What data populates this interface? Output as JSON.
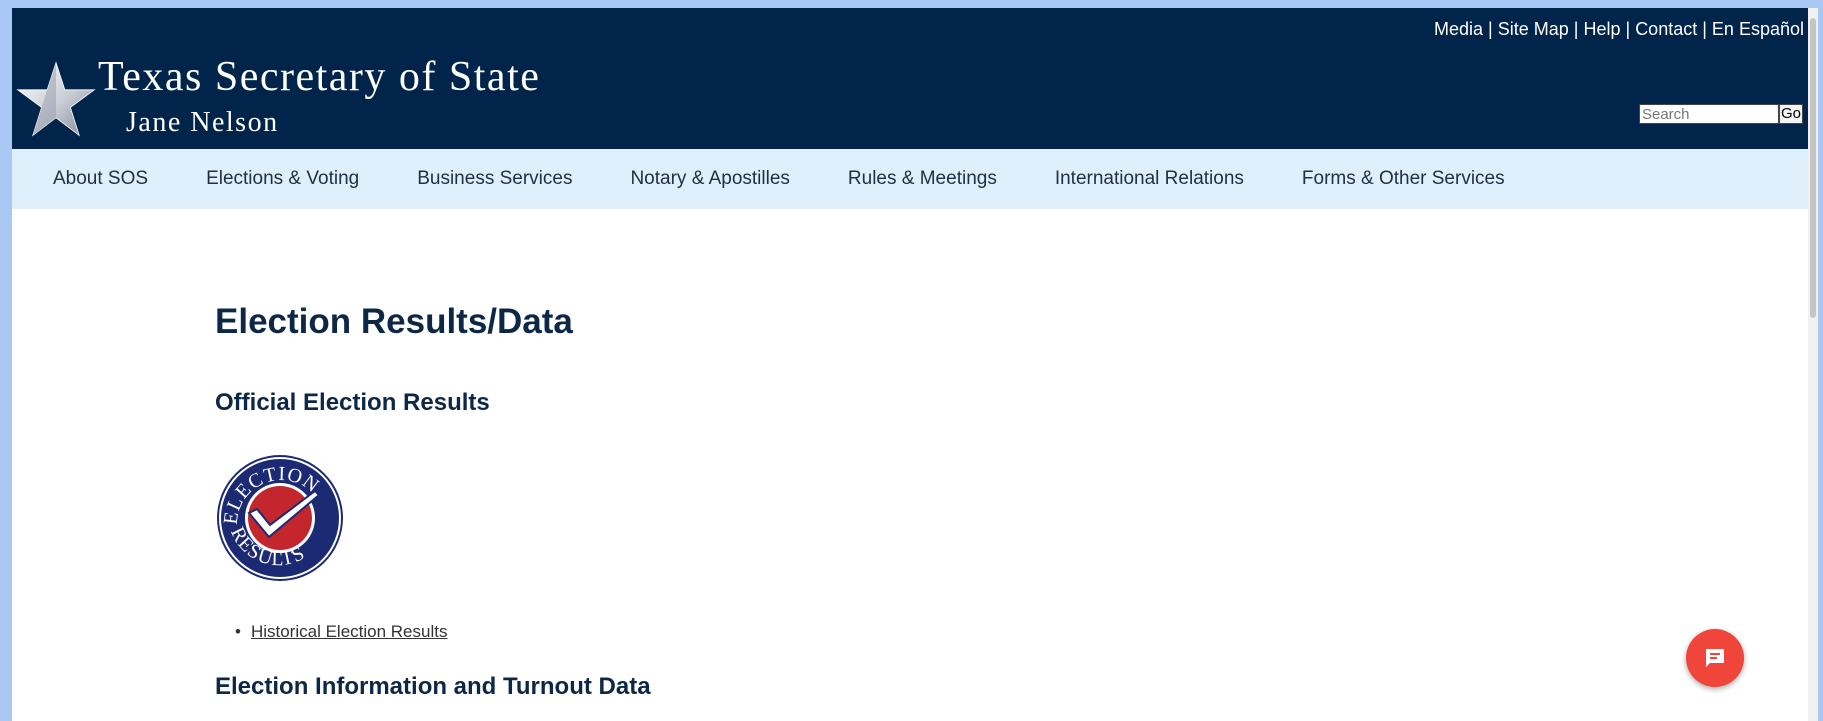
{
  "header": {
    "title": "Texas Secretary of State",
    "subtitle": "Jane Nelson",
    "utility_links": [
      "Media",
      "Site Map",
      "Help",
      "Contact",
      "En Español"
    ],
    "search": {
      "placeholder": "Search",
      "button": "Go"
    }
  },
  "nav": {
    "items": [
      "About SOS",
      "Elections & Voting",
      "Business Services",
      "Notary & Apostilles",
      "Rules & Meetings",
      "International Relations",
      "Forms & Other Services"
    ]
  },
  "main": {
    "page_title": "Election Results/Data",
    "section1_heading": "Official Election Results",
    "badge_text_top": "ELECTION",
    "badge_text_bottom": "RESULTS",
    "links": [
      "Historical Election Results"
    ],
    "section2_heading": "Election Information and Turnout Data"
  },
  "colors": {
    "header_bg": "#01244b",
    "nav_bg": "#dff0fc",
    "heading": "#0d2747",
    "chat_button": "#f0453a"
  },
  "icons": {
    "logo": "star-icon",
    "chat": "chat-icon"
  }
}
